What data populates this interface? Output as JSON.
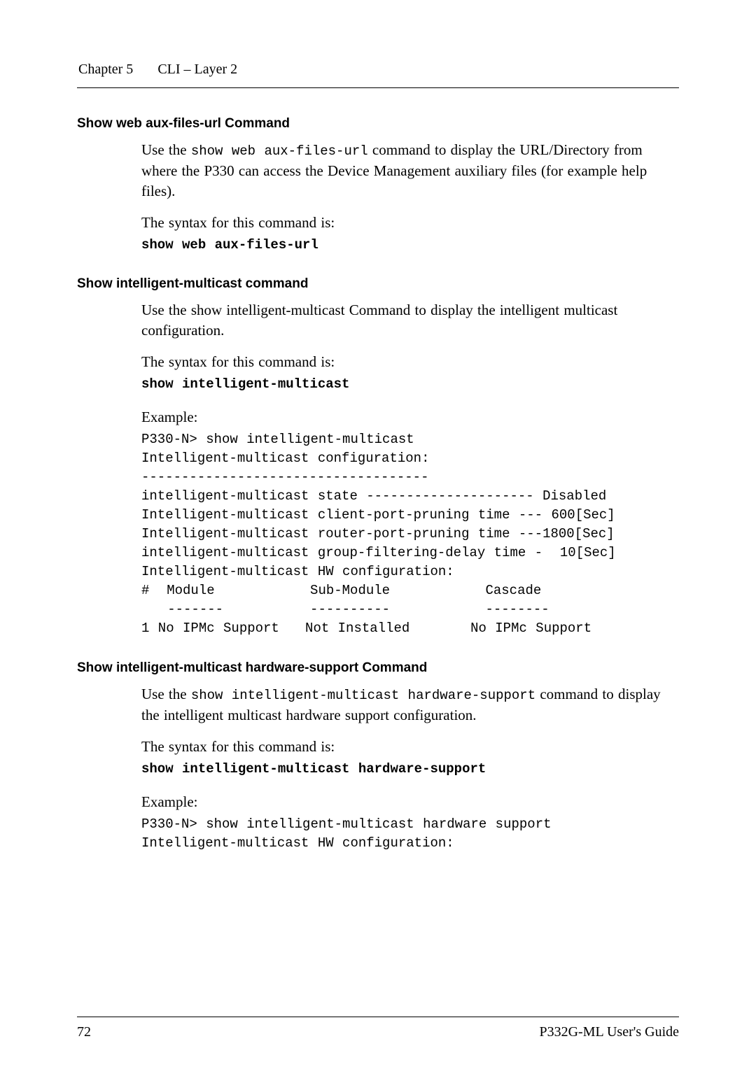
{
  "header": {
    "chapter": "Chapter 5",
    "title": "CLI – Layer 2"
  },
  "section1": {
    "heading": "Show web aux-files-url Command",
    "para1_pre": "Use the ",
    "para1_code": "show web aux-files-url",
    "para1_post": " command to display the URL/Directory from where the P330 can access the Device Management auxiliary files (for example help files).",
    "syntax_label": "The syntax for this command is:",
    "syntax_cmd": "show web aux-files-url"
  },
  "section2": {
    "heading": "Show intelligent-multicast command",
    "para1": "Use the show intelligent-multicast Command to display the intelligent multicast configuration.",
    "syntax_label": "The syntax for this command is:",
    "syntax_cmd": "show intelligent-multicast",
    "example_label": "Example:",
    "example_block": "P330-N> show intelligent-multicast\nIntelligent-multicast configuration:\n------------------------------------\nintelligent-multicast state --------------------- Disabled\nIntelligent-multicast client-port-pruning time --- 600[Sec]\nIntelligent-multicast router-port-pruning time ---1800[Sec]\nintelligent-multicast group-filtering-delay time -  10[Sec]\nIntelligent-multicast HW configuration:\n#  Module           Sub-Module           Cascade\n   -------          ----------           --------\n1 No IPMc Support   Not Installed       No IPMc Support"
  },
  "section3": {
    "heading": "Show intelligent-multicast hardware-support Command",
    "para1_pre": "Use the ",
    "para1_code": "show intelligent-multicast hardware-support",
    "para1_post": " command to display the intelligent multicast hardware support configuration.",
    "syntax_label": "The syntax for this command is:",
    "syntax_cmd": "show intelligent-multicast hardware-support",
    "example_label": "Example:",
    "example_block": "P330-N> show intelligent-multicast hardware support\nIntelligent-multicast HW configuration:"
  },
  "footer": {
    "page": "72",
    "doc": "P332G-ML User's Guide"
  }
}
